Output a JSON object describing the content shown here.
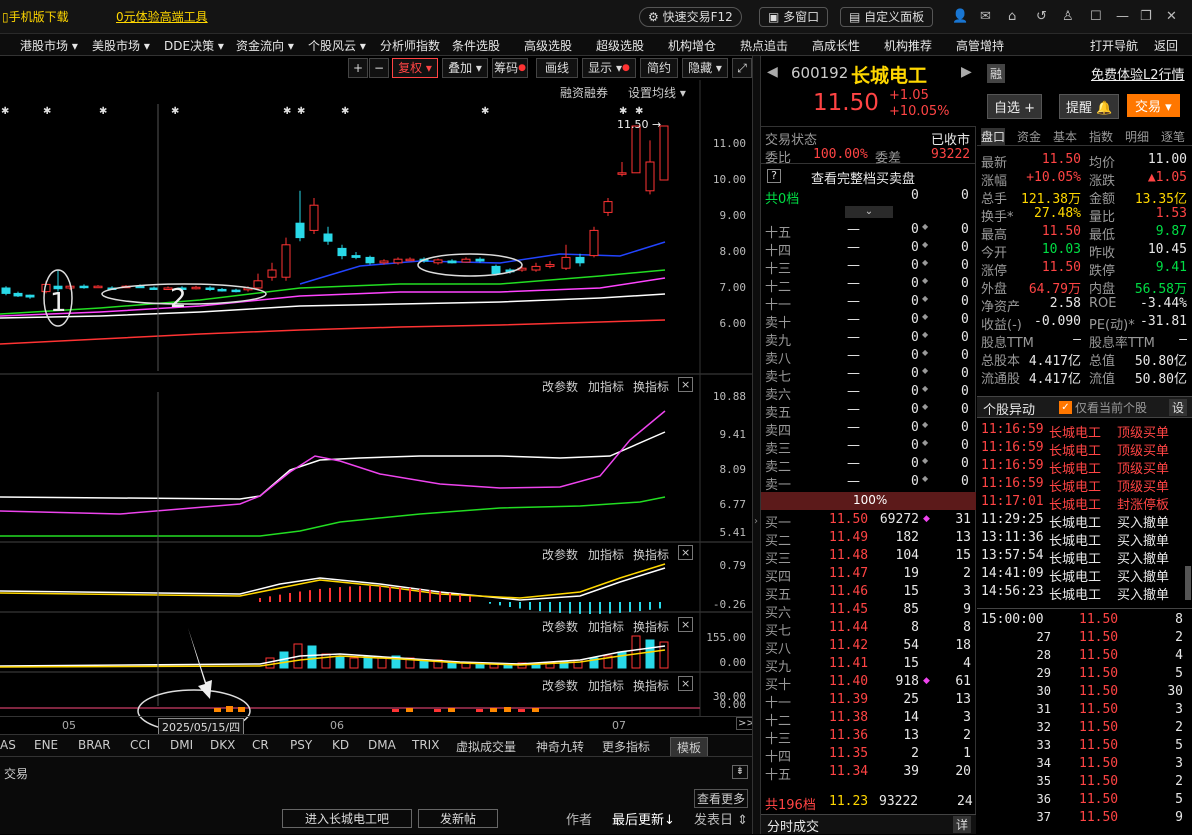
{
  "topbar": {
    "mobile": "手机版下载",
    "free_tool": "0元体验高端工具",
    "quick_trade": "快速交易F12",
    "multi_window": "多窗口",
    "custom_panel": "自定义面板"
  },
  "menu": [
    "港股市场 ▾",
    "美股市场 ▾",
    "DDE决策 ▾",
    "资金流向 ▾",
    "个股风云 ▾",
    "分析师指数",
    "条件选股",
    "高级选股",
    "超级选股",
    "机构增仓",
    "热点追击",
    "高成长性",
    "机构推荐",
    "高管增持"
  ],
  "menu_right": {
    "nav": "打开导航",
    "back": "返回"
  },
  "toolbar": {
    "plus": "+",
    "minus": "−",
    "fq": "复权",
    "overlay": "叠加",
    "chip": "筹码",
    "draw": "画线",
    "show": "显示",
    "simple": "简约",
    "hide": "隐藏"
  },
  "main_chart": {
    "margin": "融资融券",
    "ma_setting": "设置均线",
    "peak": "11.50",
    "yticks": [
      "11.00",
      "10.00",
      "9.00",
      "8.00",
      "7.00",
      "6.00"
    ],
    "ann1": "1",
    "ann2": "2"
  },
  "panel2": {
    "params": "改参数",
    "add": "加指标",
    "switch": "换指标",
    "close": "×",
    "yticks": [
      "10.88",
      "9.41",
      "8.09",
      "6.77",
      "5.41"
    ]
  },
  "panel3": {
    "params": "改参数",
    "add": "加指标",
    "switch": "换指标",
    "close": "×",
    "yticks": [
      "0.79",
      "-0.26"
    ]
  },
  "panel4": {
    "params": "改参数",
    "add": "加指标",
    "switch": "换指标",
    "close": "×",
    "yticks": [
      "155.00",
      "0.00"
    ]
  },
  "panel5": {
    "params": "改参数",
    "add": "加指标",
    "switch": "换指标",
    "close": "×",
    "yticks": [
      "30.00",
      "0.00"
    ]
  },
  "xaxis": {
    "m05": "05",
    "m06": "06",
    "m07": "07",
    "date": "2025/05/15/四",
    "more": ">>"
  },
  "tabs": [
    "AS",
    "ENE",
    "BRAR",
    "CCI",
    "DMI",
    "DKX",
    "CR",
    "PSY",
    "KD",
    "DMA",
    "TRIX",
    "虚拟成交量",
    "神奇九转",
    "更多指标"
  ],
  "tab_template": "模板",
  "bottom": {
    "trade": "交易",
    "view_more": "查看更多",
    "enter_bar": "进入长城电工吧",
    "post": "发新帖",
    "author": "作者",
    "latest": "最后更新↓",
    "reply": "发表日"
  },
  "stock": {
    "code": "600192",
    "name": "长城电工",
    "price": "11.50",
    "change": "+1.05",
    "pct": "+10.05%",
    "rong": "融",
    "l2": "免费体验L2行情",
    "zixuan": "自选 +",
    "remind": "提醒",
    "trade": "交易"
  },
  "status": {
    "label": "交易状态",
    "value": "已收市",
    "wb_label": "委比",
    "wb": "100.00%",
    "wc_label": "委差",
    "wc": "93222",
    "fullbook": "查看完整档买卖盘",
    "total0_label": "共0档",
    "total0_a": "0",
    "total0_b": "0"
  },
  "sells": [
    [
      "十五",
      "—",
      "0",
      "0"
    ],
    [
      "十四",
      "—",
      "0",
      "0"
    ],
    [
      "十三",
      "—",
      "0",
      "0"
    ],
    [
      "十二",
      "—",
      "0",
      "0"
    ],
    [
      "十一",
      "—",
      "0",
      "0"
    ],
    [
      "卖十",
      "—",
      "0",
      "0"
    ],
    [
      "卖九",
      "—",
      "0",
      "0"
    ],
    [
      "卖八",
      "—",
      "0",
      "0"
    ],
    [
      "卖七",
      "—",
      "0",
      "0"
    ],
    [
      "卖六",
      "—",
      "0",
      "0"
    ],
    [
      "卖五",
      "—",
      "0",
      "0"
    ],
    [
      "卖四",
      "—",
      "0",
      "0"
    ],
    [
      "卖三",
      "—",
      "0",
      "0"
    ],
    [
      "卖二",
      "—",
      "0",
      "0"
    ],
    [
      "卖一",
      "—",
      "0",
      "0"
    ]
  ],
  "bar_pct": "100%",
  "buys": [
    [
      "买一",
      "11.50",
      "69272",
      "31"
    ],
    [
      "买二",
      "11.49",
      "182",
      "13"
    ],
    [
      "买三",
      "11.48",
      "104",
      "15"
    ],
    [
      "买四",
      "11.47",
      "19",
      "2"
    ],
    [
      "买五",
      "11.46",
      "15",
      "3"
    ],
    [
      "买六",
      "11.45",
      "85",
      "9"
    ],
    [
      "买七",
      "11.44",
      "8",
      "8"
    ],
    [
      "买八",
      "11.42",
      "54",
      "18"
    ],
    [
      "买九",
      "11.41",
      "15",
      "4"
    ],
    [
      "买十",
      "11.40",
      "918",
      "61"
    ],
    [
      "十一",
      "11.39",
      "25",
      "13"
    ],
    [
      "十二",
      "11.38",
      "14",
      "3"
    ],
    [
      "十三",
      "11.36",
      "13",
      "2"
    ],
    [
      "十四",
      "11.35",
      "2",
      "1"
    ],
    [
      "十五",
      "11.34",
      "39",
      "20"
    ]
  ],
  "buy_total": {
    "label": "共196档",
    "price": "11.23",
    "vol": "93222",
    "n": "24"
  },
  "tick_title": "分时成交",
  "tick_detail": "详",
  "rtabs": [
    "盘口",
    "资金",
    "基本",
    "指数",
    "明细",
    "逐笔"
  ],
  "quote": [
    [
      "最新",
      "11.50",
      "均价",
      "11.00"
    ],
    [
      "涨幅",
      "+10.05%",
      "涨跌",
      "▲1.05"
    ],
    [
      "总手",
      "121.38万",
      "金额",
      "13.35亿"
    ],
    [
      "换手*",
      "27.48%",
      "量比",
      "1.53"
    ],
    [
      "最高",
      "11.50",
      "最低",
      "9.87"
    ],
    [
      "今开",
      "10.03",
      "昨收",
      "10.45"
    ],
    [
      "涨停",
      "11.50",
      "跌停",
      "9.41"
    ],
    [
      "外盘",
      "64.79万",
      "内盘",
      "56.58万"
    ],
    [
      "净资产",
      "2.58",
      "ROE",
      "-3.44%"
    ],
    [
      "收益(-)",
      "-0.090",
      "PE(动)*",
      "-31.81"
    ],
    [
      "股息TTM",
      "—",
      "股息率TTM",
      "—"
    ],
    [
      "总股本",
      "4.417亿",
      "总值",
      "50.80亿"
    ],
    [
      "流通股",
      "4.417亿",
      "流值",
      "50.80亿"
    ]
  ],
  "abnormal": {
    "title": "个股异动",
    "only_current": "仅看当前个股",
    "settings": "设"
  },
  "events": [
    [
      "11:16:59",
      "长城电工",
      "顶级买单"
    ],
    [
      "11:16:59",
      "长城电工",
      "顶级买单"
    ],
    [
      "11:16:59",
      "长城电工",
      "顶级买单"
    ],
    [
      "11:16:59",
      "长城电工",
      "顶级买单"
    ],
    [
      "11:17:01",
      "长城电工",
      "封涨停板"
    ],
    [
      "11:29:25",
      "长城电工",
      "买入撤单"
    ],
    [
      "13:11:36",
      "长城电工",
      "买入撤单"
    ],
    [
      "13:57:54",
      "长城电工",
      "买入撤单"
    ],
    [
      "14:41:09",
      "长城电工",
      "买入撤单"
    ],
    [
      "14:56:23",
      "长城电工",
      "买入撤单"
    ]
  ],
  "ticks": [
    [
      "15:00:00",
      "11.50",
      "8"
    ],
    [
      "27",
      "11.50",
      "2"
    ],
    [
      "28",
      "11.50",
      "4"
    ],
    [
      "29",
      "11.50",
      "5"
    ],
    [
      "30",
      "11.50",
      "30"
    ],
    [
      "31",
      "11.50",
      "3"
    ],
    [
      "32",
      "11.50",
      "2"
    ],
    [
      "33",
      "11.50",
      "5"
    ],
    [
      "34",
      "11.50",
      "3"
    ],
    [
      "35",
      "11.50",
      "2"
    ],
    [
      "36",
      "11.50",
      "5"
    ],
    [
      "37",
      "11.50",
      "9"
    ]
  ]
}
